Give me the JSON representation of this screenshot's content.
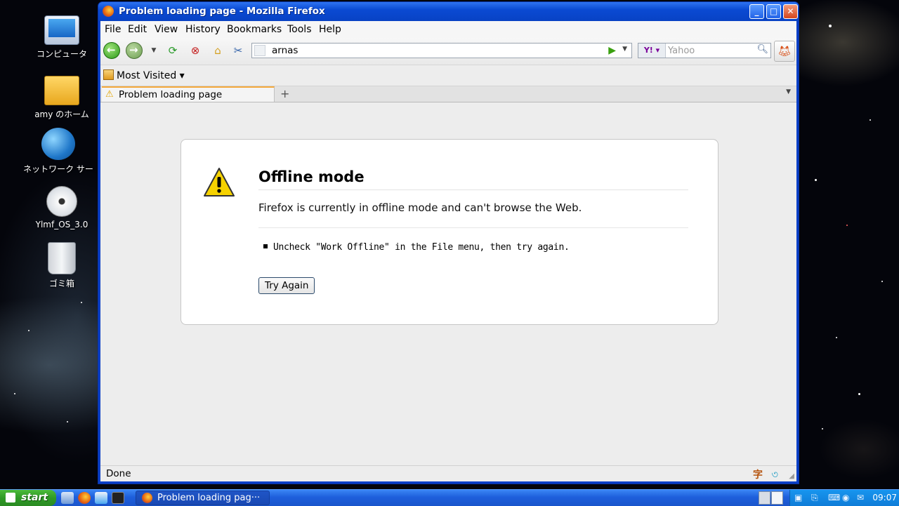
{
  "desktop": {
    "icons": [
      {
        "label": "コンピュータ",
        "icon": "computer-icon"
      },
      {
        "label": "amy のホーム",
        "icon": "home-folder-icon"
      },
      {
        "label": "ネットワーク サー",
        "icon": "network-servers-icon"
      },
      {
        "label": "Ylmf_OS_3.0",
        "icon": "disc-icon"
      },
      {
        "label": "ゴミ箱",
        "icon": "trash-icon"
      }
    ]
  },
  "window": {
    "title": "Problem loading page - Mozilla Firefox",
    "controls": {
      "minimize": "_",
      "maximize": "□",
      "close": "✕"
    }
  },
  "menu": [
    "File",
    "Edit",
    "View",
    "History",
    "Bookmarks",
    "Tools",
    "Help"
  ],
  "navigation": {
    "url": "arnas",
    "search_placeholder": "Yahoo",
    "search_engine": "Y!"
  },
  "bookmarks": {
    "most_visited": "Most Visited ▾"
  },
  "tabs": [
    {
      "title": "Problem loading page"
    }
  ],
  "error": {
    "title": "Offline mode",
    "description": "Firefox is currently in offline mode and can't browse the Web.",
    "items": [
      "Uncheck \"Work Offline\" in the File menu, then try again."
    ],
    "button": "Try Again"
  },
  "status": {
    "text": "Done",
    "ime": "字"
  },
  "taskbar": {
    "start": "start",
    "task": "Problem loading pag···",
    "clock": "09:07"
  },
  "colors": {
    "titlebar": "#0a4ad3",
    "start": "#2f9a26",
    "tab_accent": "#f4a83a"
  }
}
